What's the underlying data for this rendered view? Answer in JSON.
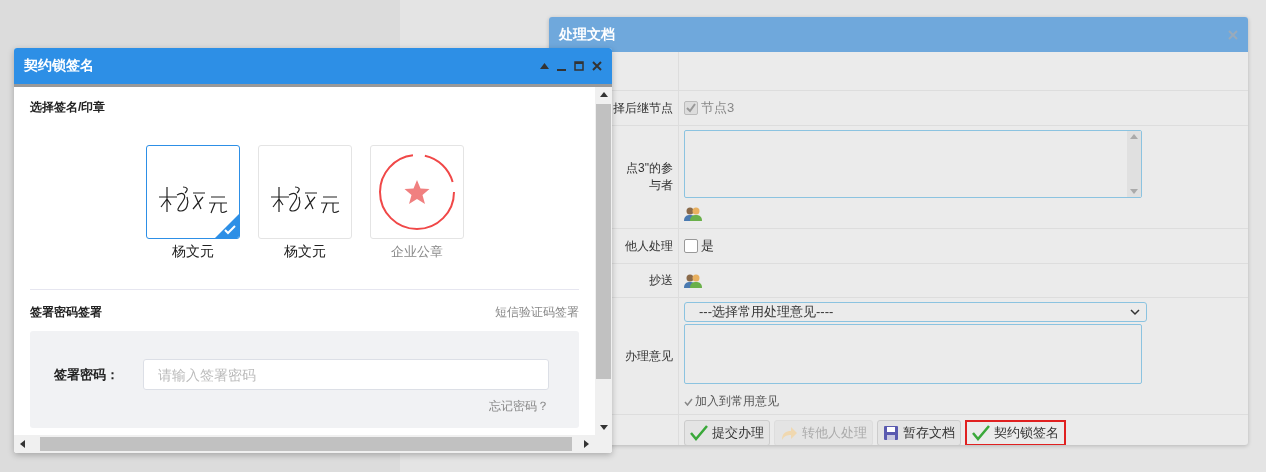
{
  "process_dialog": {
    "title": "处理文档",
    "rows": [
      {
        "kind": "blank"
      },
      {
        "kind": "checkbox",
        "label": "择后继节点",
        "option": "节点3",
        "checked": true,
        "disabled": true
      },
      {
        "kind": "participants",
        "label": "点3\"的参与者"
      },
      {
        "kind": "checkbox",
        "label": "他人处理",
        "option": "是",
        "checked": false,
        "disabled": false
      },
      {
        "kind": "people",
        "label": "抄送"
      },
      {
        "kind": "opinion",
        "label": "办理意见",
        "select": "---选择常用处理意见----",
        "add_link": "加入到常用意见"
      }
    ],
    "buttons": [
      {
        "kind": "submit",
        "label": "提交办理",
        "disabled": false,
        "highlighted": false
      },
      {
        "kind": "forward",
        "label": "转他人处理",
        "disabled": true,
        "highlighted": false
      },
      {
        "kind": "save",
        "label": "暂存文档",
        "disabled": false,
        "highlighted": false
      },
      {
        "kind": "sign",
        "label": "契约锁签名",
        "disabled": false,
        "highlighted": true
      }
    ]
  },
  "sign_dialog": {
    "title": "契约锁签名",
    "section_title": "选择签名/印章",
    "seals": [
      {
        "kind": "signature",
        "name": "杨文元",
        "selected": true
      },
      {
        "kind": "signature",
        "name": "杨文元",
        "selected": false
      },
      {
        "kind": "stamp",
        "name": "企业公章",
        "selected": false
      }
    ],
    "password_title": "签署密码签署",
    "sms_link": "短信验证码签署",
    "password_label": "签署密码：",
    "password_placeholder": "请输入签署密码",
    "forgot_link": "忘记密码？"
  }
}
